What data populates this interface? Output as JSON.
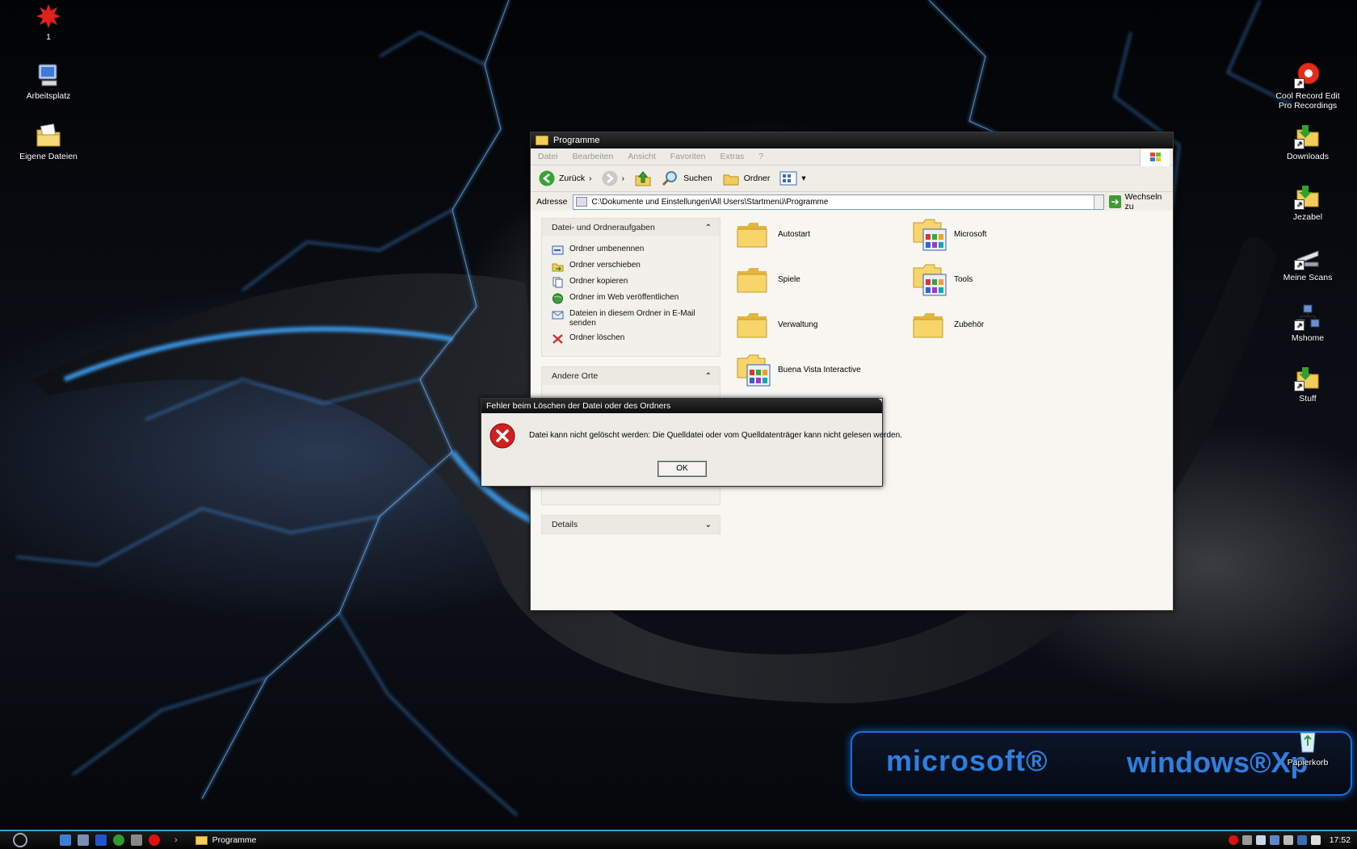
{
  "desktop": {
    "left_icons": [
      {
        "label": "1"
      },
      {
        "label": "Arbeitsplatz"
      },
      {
        "label": "Eigene Dateien"
      }
    ],
    "right_icons": [
      {
        "label": "Cool Record Edit Pro Recordings"
      },
      {
        "label": "Downloads"
      },
      {
        "label": "Jezabel"
      },
      {
        "label": "Meine Scans"
      },
      {
        "label": "Mshome"
      },
      {
        "label": "Stuff"
      }
    ],
    "recycle_bin": "Papierkorb",
    "brand_left": "microsoft®",
    "brand_right": "windows®Xp"
  },
  "explorer": {
    "title": "Programme",
    "menu": [
      "Datei",
      "Bearbeiten",
      "Ansicht",
      "Favoriten",
      "Extras",
      "?"
    ],
    "toolbar": {
      "back": "Zurück",
      "search": "Suchen",
      "folders": "Ordner"
    },
    "address": {
      "label": "Adresse",
      "value": "C:\\Dokumente und Einstellungen\\All Users\\Startmenü\\Programme",
      "go": "Wechseln zu"
    },
    "tasks": {
      "header": "Datei- und Ordneraufgaben",
      "items": [
        "Ordner umbenennen",
        "Ordner verschieben",
        "Ordner kopieren",
        "Ordner im Web veröffentlichen",
        "Dateien in diesem Ordner in E-Mail senden",
        "Ordner löschen"
      ]
    },
    "other_places": {
      "header": "Andere Orte"
    },
    "details": {
      "header": "Details"
    },
    "files": [
      {
        "name": "Autostart",
        "special": false
      },
      {
        "name": "Microsoft",
        "special": true
      },
      {
        "name": "Spiele",
        "special": false
      },
      {
        "name": "Tools",
        "special": true
      },
      {
        "name": "Verwaltung",
        "special": false
      },
      {
        "name": "Zubehör",
        "special": false
      },
      {
        "name": "Buena Vista Interactive",
        "special": true
      }
    ]
  },
  "dialog": {
    "title": "Fehler beim Löschen der Datei oder des Ordners",
    "message": "Datei kann nicht gelöscht werden: Die Quelldatei oder vom Quelldatenträger kann nicht gelesen werden.",
    "ok": "OK"
  },
  "taskbar": {
    "task": "Programme",
    "clock": "17:52"
  },
  "colors": {
    "accent": "#2f9fc7",
    "folder": "#f2cc5c",
    "error": "#d21f1f"
  }
}
